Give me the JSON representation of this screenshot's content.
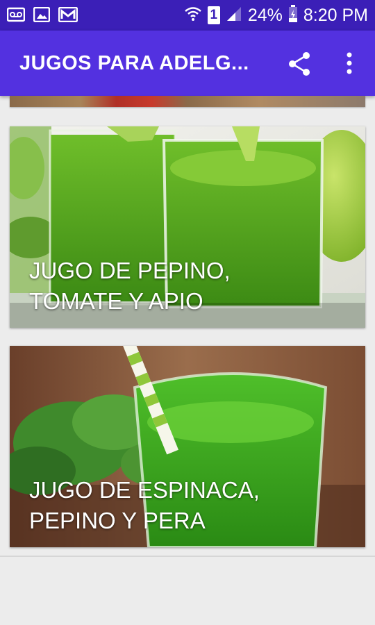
{
  "status_bar": {
    "battery": "24%",
    "time": "8:20 PM",
    "sim": "1",
    "icons": [
      "voicemail-icon",
      "image-icon",
      "gmail-icon",
      "wifi-icon",
      "sim-icon",
      "signal-icon",
      "battery-icon"
    ]
  },
  "app_bar": {
    "title": "JUGOS PARA ADELG...",
    "actions": [
      "share-icon",
      "more-vert-icon"
    ],
    "color": "#5331e0"
  },
  "cards": [
    {
      "title_line1": "JUGO DE PEPINO,",
      "title_line2": "TOMATE Y APIO"
    },
    {
      "title_line1": "JUGO DE ESPINACA,",
      "title_line2": "PEPINO Y PERA"
    }
  ],
  "colors": {
    "status_bar": "#3b1fb7",
    "background": "#ececec"
  }
}
